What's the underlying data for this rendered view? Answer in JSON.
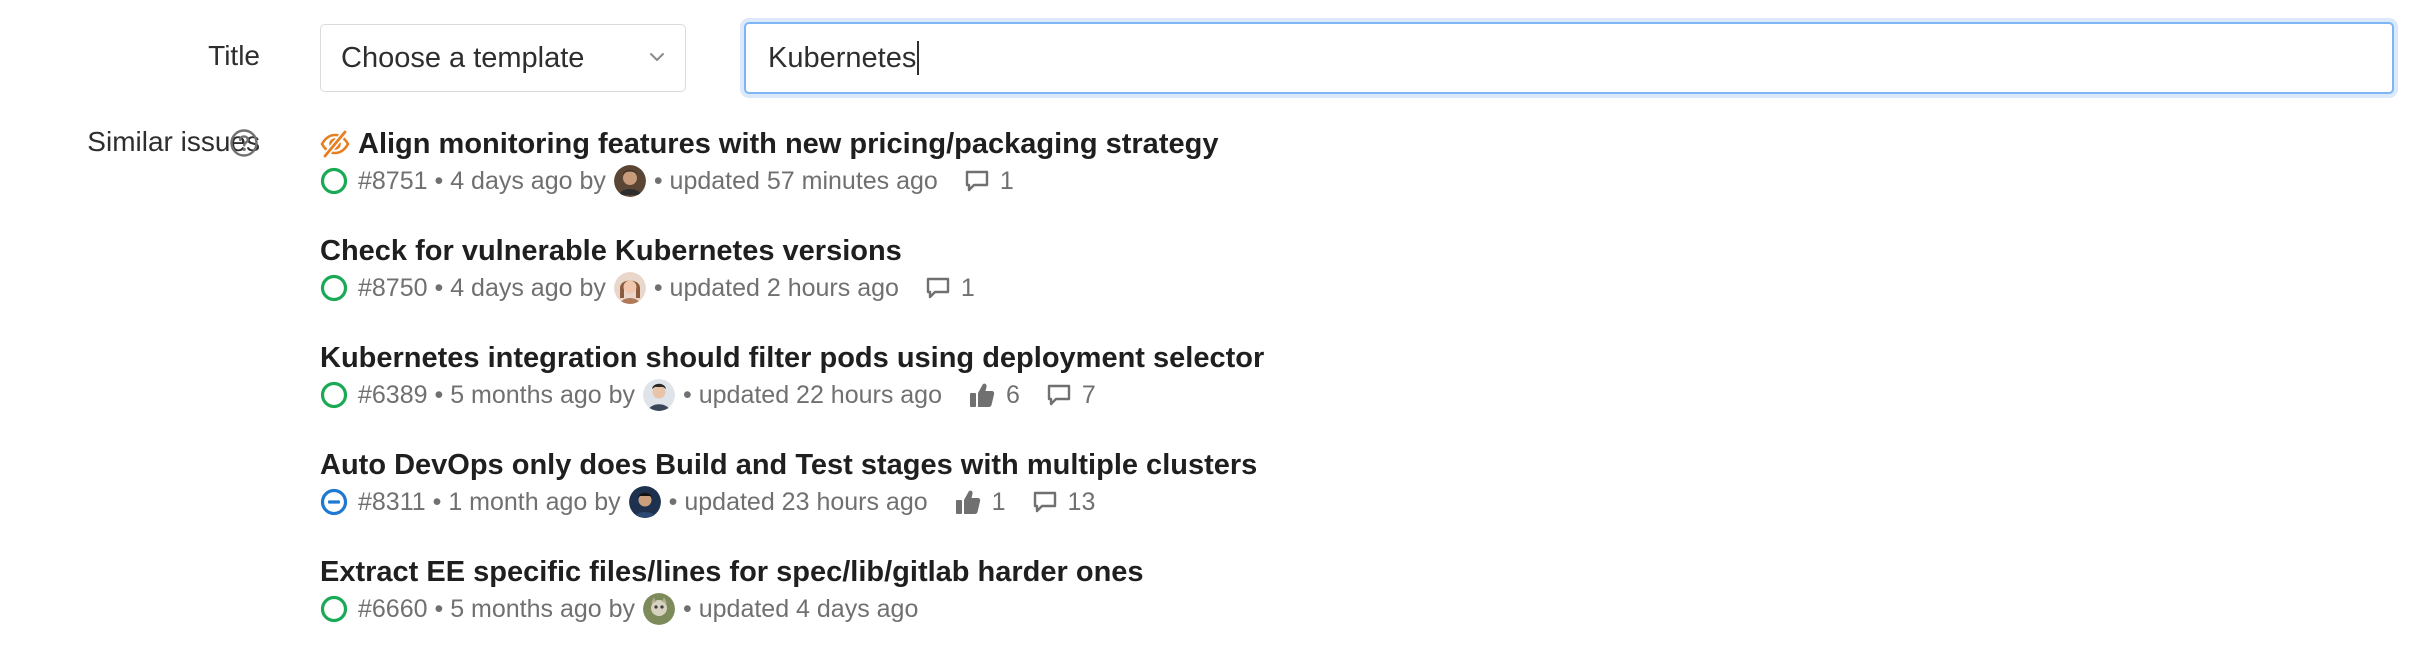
{
  "form": {
    "title_label": "Title",
    "template_select": {
      "value": "Choose a template"
    },
    "title_input": {
      "value": "Kubernetes"
    },
    "similar_label": "Similar issues"
  },
  "colors": {
    "open_state": "#1aaa55",
    "closed_state": "#1f78d1",
    "confidential": "#e67e22",
    "meta_text": "#707070",
    "focus_border": "#7eb6f5"
  },
  "issues": [
    {
      "title": "Align monitoring features with new pricing/packaging strategy",
      "confidential_icon": "eye-slash-icon",
      "state": "open",
      "number": "#8751",
      "created": "4 days ago by",
      "updated": "• updated 57 minutes ago",
      "upvotes": "",
      "comments": "1"
    },
    {
      "title": "Check for vulnerable Kubernetes versions",
      "state": "open",
      "number": "#8750",
      "created": "4 days ago by",
      "updated": "• updated 2 hours ago",
      "upvotes": "",
      "comments": "1"
    },
    {
      "title": "Kubernetes integration should filter pods using deployment selector",
      "state": "open",
      "number": "#6389",
      "created": "5 months ago by",
      "updated": "• updated 22 hours ago",
      "upvotes": "6",
      "comments": "7"
    },
    {
      "title": "Auto DevOps only does Build and Test stages with multiple clusters",
      "state": "closed",
      "number": "#8311",
      "created": "1 month ago by",
      "updated": "• updated 23 hours ago",
      "upvotes": "1",
      "comments": "13"
    },
    {
      "title": "Extract EE specific files/lines for spec/lib/gitlab harder ones",
      "state": "open",
      "number": "#6660",
      "created": "5 months ago by",
      "updated": "• updated 4 days ago",
      "upvotes": "",
      "comments": ""
    }
  ]
}
